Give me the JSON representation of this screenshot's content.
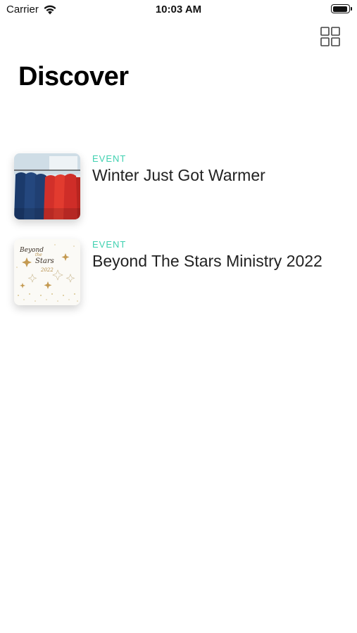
{
  "status_bar": {
    "carrier": "Carrier",
    "time": "10:03 AM",
    "wifi_icon": "wifi-icon",
    "battery_icon": "battery-icon"
  },
  "header": {
    "grid_icon": "grid-icon",
    "title": "Discover"
  },
  "colors": {
    "accent": "#3fd1b0",
    "text": "#222222",
    "background": "#ffffff"
  },
  "items": [
    {
      "label": "EVENT",
      "title": "Winter Just Got Warmer",
      "thumbnail": "coats-on-rack-image"
    },
    {
      "label": "EVENT",
      "title": "Beyond The Stars Ministry 2022",
      "thumbnail": "beyond-the-stars-poster-image",
      "thumbnail_text": [
        "Beyond",
        "the",
        "Stars",
        "2022"
      ]
    }
  ]
}
